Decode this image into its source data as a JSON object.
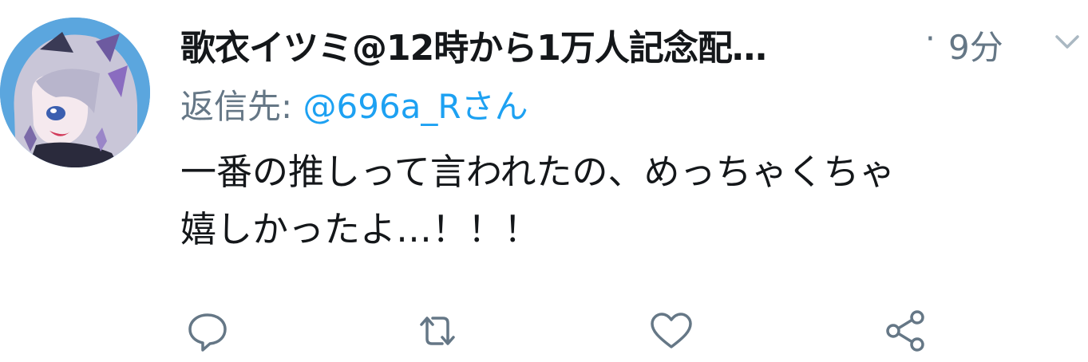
{
  "tweet": {
    "author": {
      "display_name": "歌衣イツミ@12時から1万人記念配…",
      "avatar_icon": "avatar-image"
    },
    "separator": "·",
    "timestamp": "9分",
    "reply": {
      "prefix": "返信先: ",
      "handle": "@696a_Rさん"
    },
    "text_lines": [
      "一番の推しって言われたの、めっちゃくちゃ",
      "嬉しかったよ…！！！"
    ],
    "actions": [
      {
        "name": "reply",
        "icon": "comment-icon"
      },
      {
        "name": "retweet",
        "icon": "retweet-icon"
      },
      {
        "name": "like",
        "icon": "heart-icon"
      },
      {
        "name": "share",
        "icon": "share-icon"
      }
    ],
    "colors": {
      "text": "#14171a",
      "secondary": "#657786",
      "link": "#1da1f2",
      "avatar_bg": "#5ba6de"
    }
  }
}
